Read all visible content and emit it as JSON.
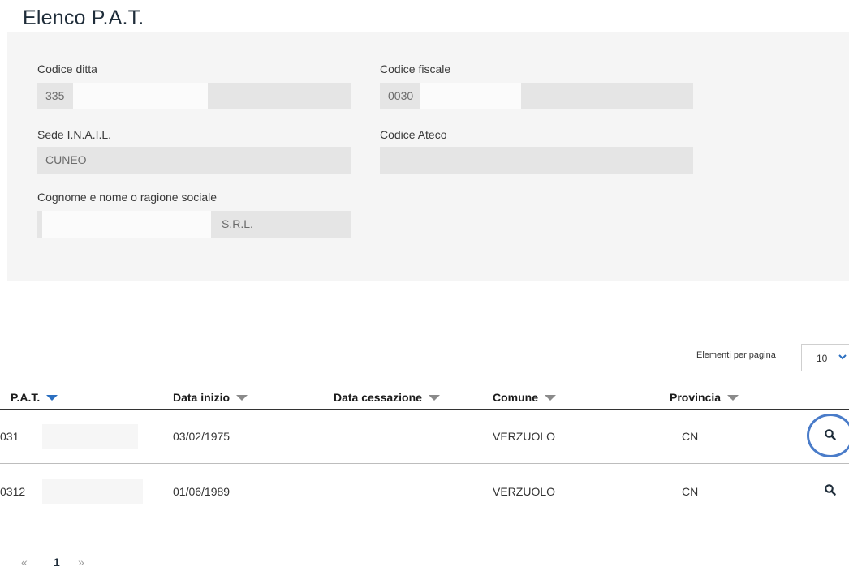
{
  "page_title": "Elenco P.A.T.",
  "form": {
    "codice_ditta": {
      "label": "Codice ditta",
      "value": "335"
    },
    "codice_fiscale": {
      "label": "Codice fiscale",
      "value": "0030"
    },
    "sede_inail": {
      "label": "Sede I.N.A.I.L.",
      "value": "CUNEO"
    },
    "codice_ateco": {
      "label": "Codice Ateco",
      "value": ""
    },
    "ragione_sociale": {
      "label": "Cognome e nome o ragione sociale",
      "value": "S.R.L."
    }
  },
  "pagination_size": {
    "label": "Elementi per pagina",
    "value": "10"
  },
  "table": {
    "headers": [
      "P.A.T.",
      "Data inizio",
      "Data cessazione",
      "Comune",
      "Provincia"
    ],
    "rows": [
      {
        "pat": "031",
        "data_inizio": "03/02/1975",
        "data_cessazione": "",
        "comune": "VERZUOLO",
        "provincia": "CN"
      },
      {
        "pat": "0312",
        "data_inizio": "01/06/1989",
        "data_cessazione": "",
        "comune": "VERZUOLO",
        "provincia": "CN"
      }
    ]
  },
  "pagination": {
    "prev": "«",
    "current": "1",
    "next": "»"
  },
  "colors": {
    "accent": "#2b6fc0",
    "highlight": "#4a7cc9"
  },
  "icons": {
    "row_action": "search-icon"
  }
}
